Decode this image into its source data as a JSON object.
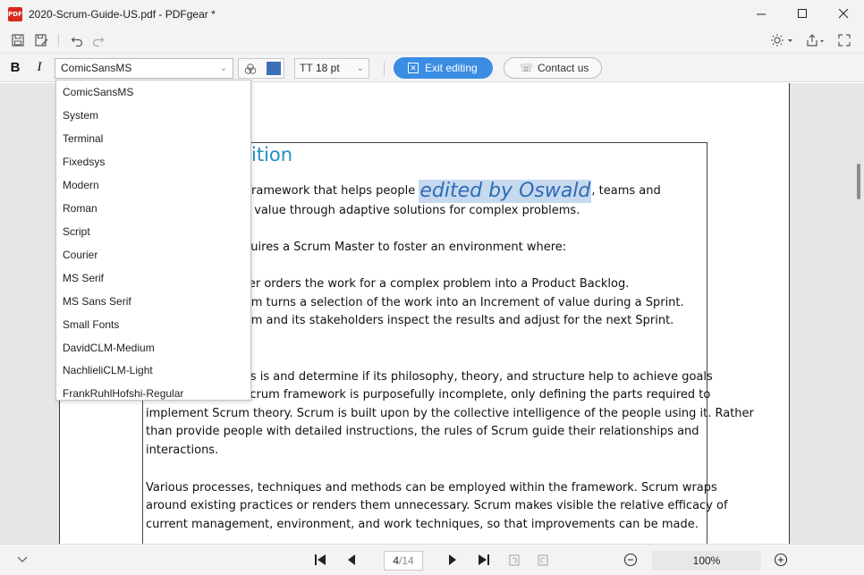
{
  "window": {
    "title": "2020-Scrum-Guide-US.pdf - PDFgear *",
    "logo_text": "PDF"
  },
  "toolbar2": {
    "bold_label": "B",
    "italic_label": "I",
    "font_value": "ComicSansMS",
    "size_value": "18 pt",
    "size_icon_text": "TT",
    "exit_label": "Exit editing",
    "contact_label": "Contact us",
    "color_swatch": "#3b6fb6"
  },
  "font_list": [
    "ComicSansMS",
    "System",
    "Terminal",
    "Fixedsys",
    "Modern",
    "Roman",
    "Script",
    "Courier",
    "MS Serif",
    "MS Sans Serif",
    "Small Fonts",
    "DavidCLM-Medium",
    "NachlieliCLM-Light",
    "FrankRuhlHofshi-Regular"
  ],
  "document": {
    "section_title_partial": "ition",
    "edited_text": "edited by Oswald",
    "line1_before": "ht framework that helps people ",
    "line1_after": ", teams and",
    "line2": "ate value through adaptive solutions for complex problems.",
    "line3": "requires a Scrum Master to foster an environment where:",
    "line4": "wner orders the work for a complex problem into a Product Backlog.",
    "line5": "Team turns a selection of the work into an Increment of value during a Sprint.",
    "line6": "Team and its stakeholders inspect the results and adjust for the next Sprint.",
    "line7": "it as is and determine if its philosophy, theory, and structure help to achieve goals",
    "line8": "e Scrum framework is purposefully incomplete, only defining the parts required to",
    "line9": "implement Scrum theory. Scrum is built upon by the collective intelligence of the people using it. Rather",
    "line10": "than provide people with detailed instructions, the rules of Scrum guide their relationships and",
    "line11": "interactions.",
    "line12": "Various processes, techniques and methods can be employed within the framework. Scrum wraps",
    "line13": "around existing practices or renders them unnecessary. Scrum makes visible the relative efficacy of",
    "line14": "current management, environment, and work techniques, so that improvements can be made."
  },
  "pager": {
    "current_page": "4",
    "total_pages": "/14",
    "zoom": "100%"
  },
  "colors": {
    "accent": "#3b8de4",
    "title_blue": "#1e8fc7",
    "highlight": "#c7d9ef"
  }
}
